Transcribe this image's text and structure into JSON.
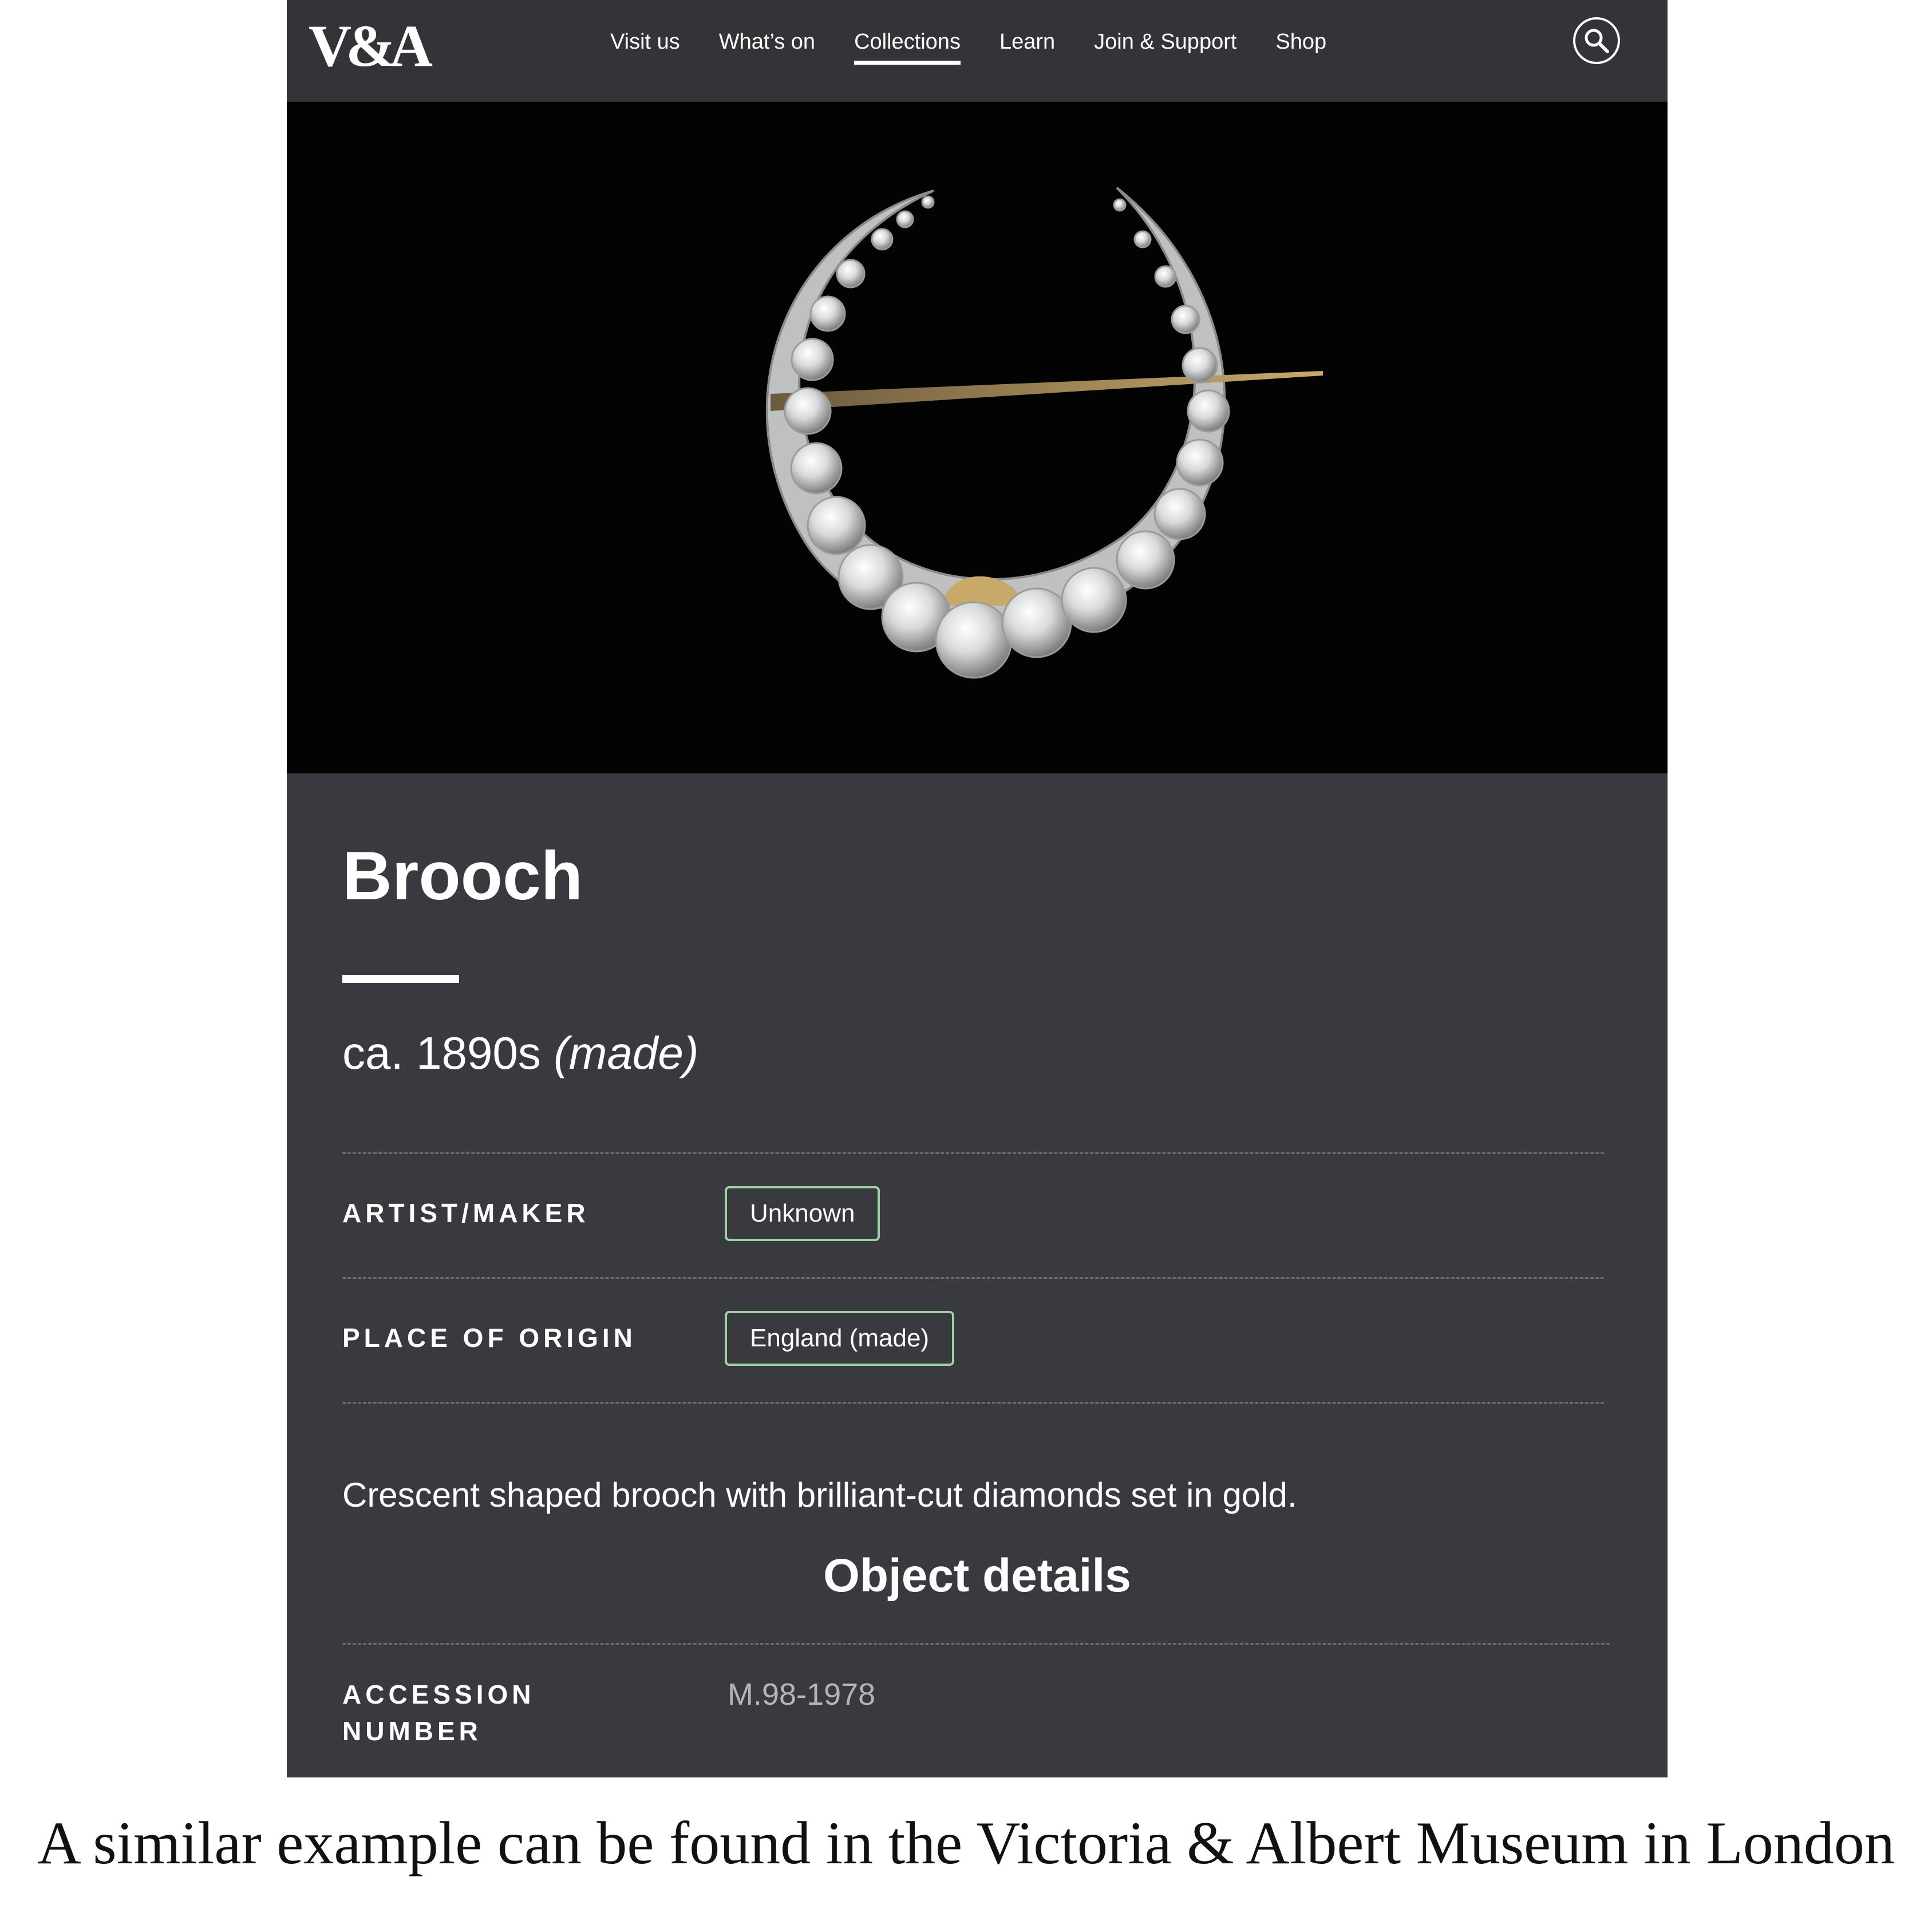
{
  "nav": {
    "logo": "V&A",
    "items": [
      {
        "label": "Visit us",
        "active": false
      },
      {
        "label": "What’s on",
        "active": false
      },
      {
        "label": "Collections",
        "active": true
      },
      {
        "label": "Learn",
        "active": false
      },
      {
        "label": "Join & Support",
        "active": false
      },
      {
        "label": "Shop",
        "active": false
      }
    ],
    "search_icon": "search-icon"
  },
  "hero": {
    "subject": "crescent brooch with diamonds on black background"
  },
  "object": {
    "title": "Brooch",
    "date": "ca. 1890s",
    "date_note": "(made)",
    "fields": [
      {
        "label": "ARTIST/MAKER",
        "value": "Unknown"
      },
      {
        "label": "PLACE OF ORIGIN",
        "value": "England (made)"
      }
    ],
    "description": "Crescent shaped brooch with brilliant-cut diamonds set in gold.",
    "details_heading": "Object details",
    "accession": {
      "label_line1": "ACCESSION",
      "label_line2": "NUMBER",
      "value": "M.98-1978"
    }
  },
  "caption": "A similar example can be found in the Victoria & Albert Museum in London",
  "colors": {
    "panel": "#393a3f",
    "nav": "#333438",
    "tag_border": "#9ed1a6"
  }
}
